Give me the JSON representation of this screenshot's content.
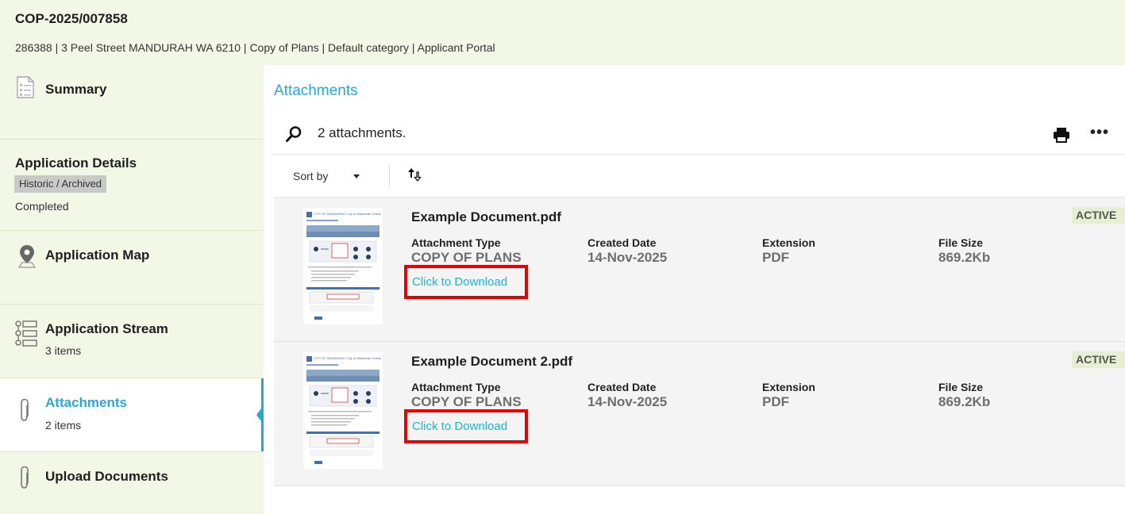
{
  "header": {
    "ref": "COP-2025/007858",
    "meta": "286388 | 3 Peel Street MANDURAH WA 6210 | Copy of Plans | Default category | Applicant Portal"
  },
  "sidebar": {
    "items": [
      {
        "title": "Summary",
        "icon": "document-icon"
      },
      {
        "title": "Application Details",
        "chip": "Historic / Archived",
        "sub": "Completed"
      },
      {
        "title": "Application Map",
        "icon": "map-pin-icon"
      },
      {
        "title": "Application Stream",
        "sub": "3 items",
        "icon": "list-icon"
      },
      {
        "title": "Attachments",
        "sub": "2 items",
        "icon": "paperclip-icon",
        "active": true
      },
      {
        "title": "Upload Documents",
        "icon": "paperclip-icon"
      }
    ]
  },
  "main": {
    "title": "Attachments",
    "count": "2 attachments.",
    "sort_label": "Sort by",
    "field_labels": {
      "type": "Attachment Type",
      "created": "Created Date",
      "extension": "Extension",
      "size": "File Size"
    },
    "attachments": [
      {
        "name": "Example Document.pdf",
        "status": "ACTIVE",
        "type": "COPY OF PLANS",
        "created": "14-Nov-2025",
        "extension": "PDF",
        "size": "869.2Kb",
        "download": "Click to Download"
      },
      {
        "name": "Example Document 2.pdf",
        "status": "ACTIVE",
        "type": "COPY OF PLANS",
        "created": "14-Nov-2025",
        "extension": "PDF",
        "size": "869.2Kb",
        "download": "Click to Download"
      }
    ]
  },
  "thumbnail": {
    "logo": "CITY OF MANDURAH",
    "header": "City of Mandurah Online"
  },
  "colors": {
    "header_bg": "#f3f8e6",
    "accent": "#2aa7d6",
    "link": "#1ab6cf",
    "highlight_box": "#e60000",
    "status_bg": "#e6efd2"
  }
}
